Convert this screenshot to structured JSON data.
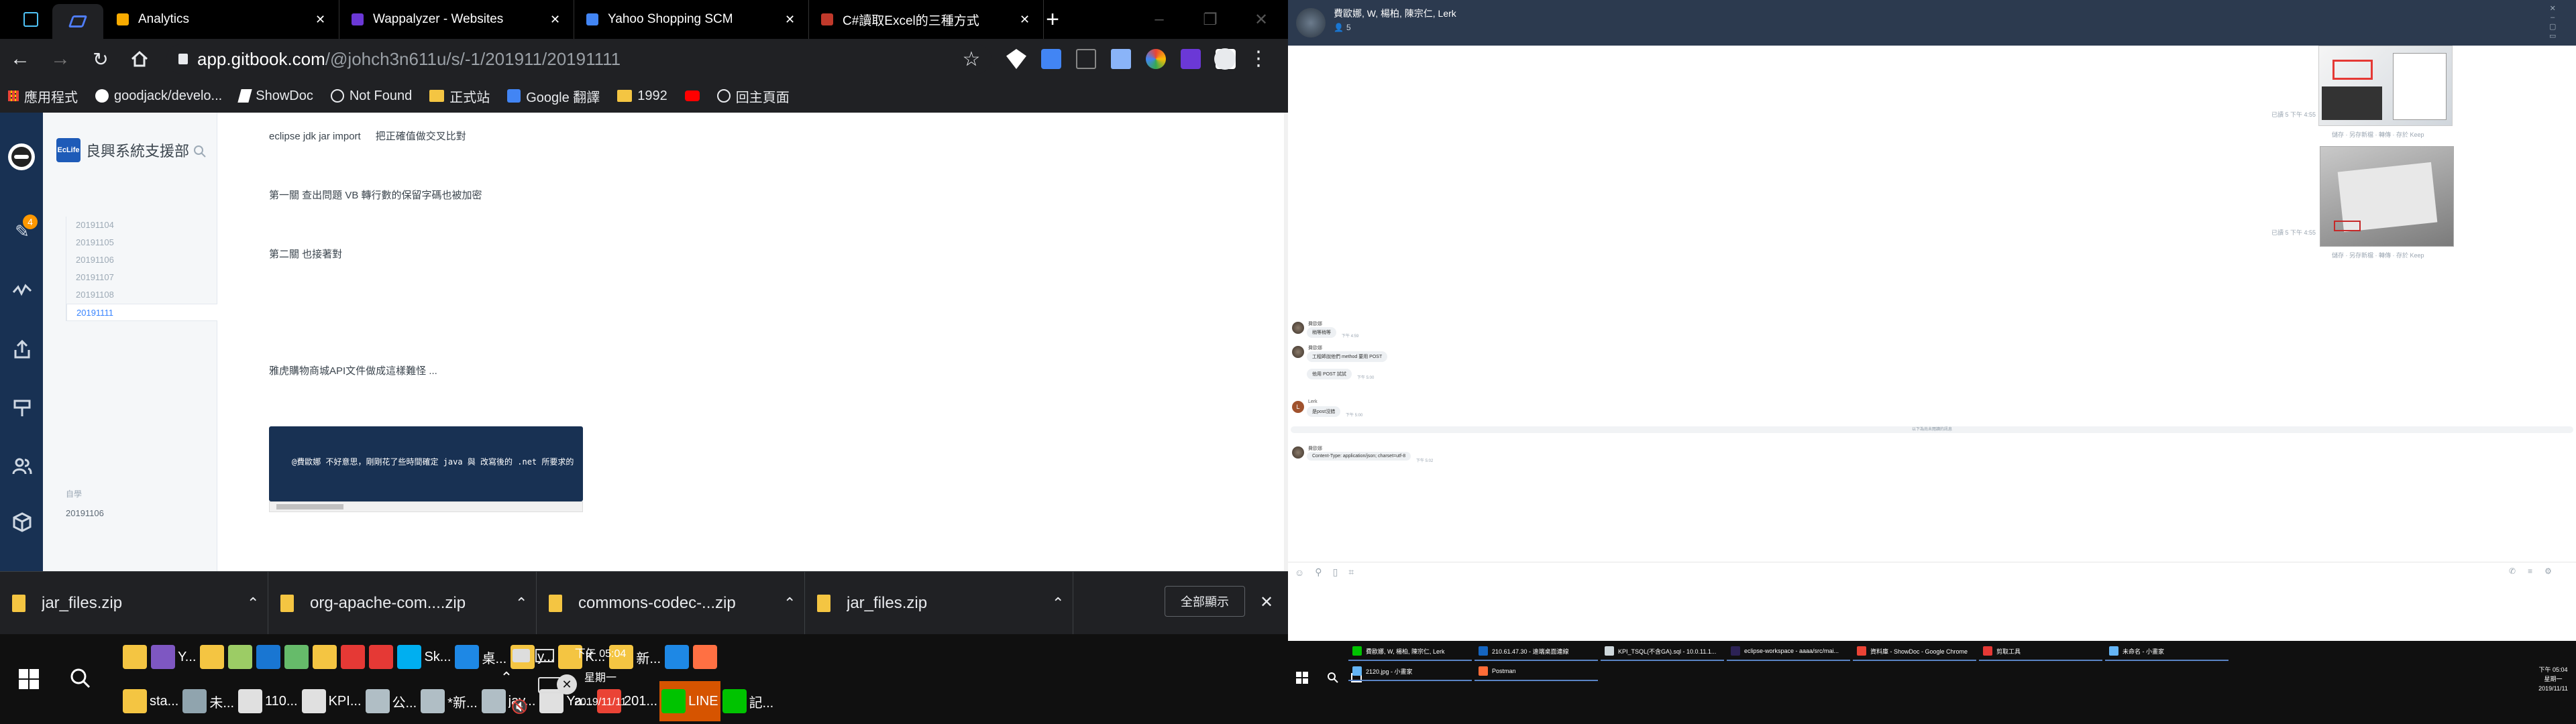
{
  "browser": {
    "tabs": [
      {
        "title": "Analytics",
        "icon": "analytics-icon",
        "color": "#f9ab00"
      },
      {
        "title": "Wappalyzer - Websites",
        "icon": "wappalyzer-icon",
        "color": "#6b38d6"
      },
      {
        "title": "Yahoo Shopping SCM",
        "icon": "docs-icon",
        "color": "#4285f4"
      },
      {
        "title": "C#讀取Excel的三種方式",
        "icon": "page-icon",
        "color": "#c0392b"
      }
    ],
    "url_host": "app.gitbook.com",
    "url_path": "/@johch3n611u/s/-1/201911/20191111",
    "bookmarks": [
      {
        "label": "應用程式",
        "icon": "apps-grid-icon"
      },
      {
        "label": "goodjack/develo...",
        "icon": "github-icon"
      },
      {
        "label": "ShowDoc",
        "icon": "showdoc-icon"
      },
      {
        "label": "Not Found",
        "icon": "globe-icon"
      },
      {
        "label": "正式站",
        "icon": "folder-icon"
      },
      {
        "label": "Google 翻譯",
        "icon": "translate-icon"
      },
      {
        "label": "1992",
        "icon": "folder-icon"
      },
      {
        "label": "",
        "icon": "youtube-icon"
      },
      {
        "label": "回主頁面",
        "icon": "globe-icon"
      }
    ]
  },
  "gitbook": {
    "space_title": "良興系統支援部",
    "logo_text": "EcLife",
    "notif_count": "4",
    "nav_items": [
      "20191104",
      "20191105",
      "20191106",
      "20191107",
      "20191108",
      "20191111"
    ],
    "active_item": "20191111",
    "section_label": "自學",
    "cut_item": "20191106"
  },
  "content": {
    "line1_a": "eclipse jdk jar import",
    "line1_b": "把正確值做交叉比對",
    "line2": "第一關 查出問題 VB 轉行數的保留字碼也被加密",
    "line3": "第二關 也接著對",
    "line4": "雅虎購物商城API文件做成這樣難怪 ...",
    "code": "@費歐娜 不好意思，剛剛花了些時間確定 java 與 改寫後的 .net 所要求的"
  },
  "downloads": {
    "items": [
      "jar_files.zip",
      "org-apache-com....zip",
      "commons-codec-...zip",
      "jar_files.zip"
    ],
    "show_all": "全部顯示"
  },
  "left_taskbar": {
    "row1": [
      {
        "label": "",
        "color": "#f4c542"
      },
      {
        "label": "Y...",
        "color": "#7e57c2"
      },
      {
        "label": "",
        "color": "#f4c542"
      },
      {
        "label": "",
        "color": "#9ccc65"
      },
      {
        "label": "",
        "color": "#1976d2"
      },
      {
        "label": "",
        "color": "#66bb6a"
      },
      {
        "label": "",
        "color": "#f4c542"
      },
      {
        "label": "",
        "color": "#e53935"
      },
      {
        "label": "",
        "color": "#e53935"
      },
      {
        "label": "Sk...",
        "color": "#00aff0"
      },
      {
        "label": "桌...",
        "color": "#1e88e5"
      },
      {
        "label": "y...",
        "color": "#f4c542"
      },
      {
        "label": "K...",
        "color": "#f4c542"
      },
      {
        "label": "新...",
        "color": "#f4c542"
      },
      {
        "label": "",
        "color": "#1e88e5"
      },
      {
        "label": "",
        "color": "#ff7043"
      }
    ],
    "row2": [
      {
        "label": "sta...",
        "color": "#f4c542"
      },
      {
        "label": "未...",
        "color": "#90a4ae"
      },
      {
        "label": "110...",
        "color": "#e0e0e0"
      },
      {
        "label": "KPI...",
        "color": "#e0e0e0"
      },
      {
        "label": "公...",
        "color": "#b0bec5"
      },
      {
        "label": "*新...",
        "color": "#b0bec5"
      },
      {
        "label": "jav...",
        "color": "#b0bec5"
      },
      {
        "label": "Ya...",
        "color": "#e0e0e0"
      },
      {
        "label": "201...",
        "color": "#ea4335"
      },
      {
        "label": "LINE",
        "color": "#00c300"
      },
      {
        "label": "記...",
        "color": "#00c300"
      }
    ],
    "time": "下午 05:04",
    "weekday": "星期一",
    "date": "2019/11/11"
  },
  "line_chat": {
    "title": "費歐娜, W, 楊柏, 陳宗仁, Lerk",
    "members": "5",
    "image_time": "已讀 5 下午 4:55",
    "image_actions": "儲存 · 另存新檔 · 轉傳 · 存於 Keep",
    "messages": [
      {
        "sender": "費歐娜",
        "text": "稍等稍等",
        "time": "下午 4:59",
        "avatar": "photo"
      },
      {
        "sender": "費歐娜",
        "text": "工程師說他們 method 要用 POST",
        "time": "",
        "avatar": "photo"
      },
      {
        "sender": "",
        "text": "他用 POST 試試",
        "time": "下午 5:00",
        "avatar": "none"
      },
      {
        "sender": "Lerk",
        "text": "是post沒錯",
        "time": "下午 5:00",
        "avatar": "letter"
      },
      {
        "sender": "費歐娜",
        "text": "Content-Type: application/json; charset=utf-8",
        "time": "下午 5:02",
        "avatar": "photo"
      }
    ],
    "unread_divider": "以下為尚未閱讀的訊息",
    "lerk_initial": "L"
  },
  "right_taskbar": {
    "row1": [
      {
        "label": "費歐娜, W, 楊柏, 陳宗仁, Lerk",
        "color": "#00c300"
      },
      {
        "label": "210.61.47.30 - 遠端桌面連線",
        "color": "#1565c0"
      },
      {
        "label": "KPI_TSQL(不含GA).sql - 10.0.11.1...",
        "color": "#cfd8dc"
      },
      {
        "label": "eclipse-workspace - aaaa/src/mai...",
        "color": "#2c2255"
      },
      {
        "label": "資料庫 - ShowDoc - Google Chrome",
        "color": "#ea4335"
      },
      {
        "label": "剪取工具",
        "color": "#e53935"
      },
      {
        "label": "未命名 - 小畫家",
        "color": "#64b5f6"
      }
    ],
    "row2": [
      {
        "label": "2120.jpg - 小畫家",
        "color": "#64b5f6"
      },
      {
        "label": "Postman",
        "color": "#ff6c37"
      }
    ],
    "time": "下午 05:04",
    "weekday": "星期一",
    "date": "2019/11/11"
  }
}
